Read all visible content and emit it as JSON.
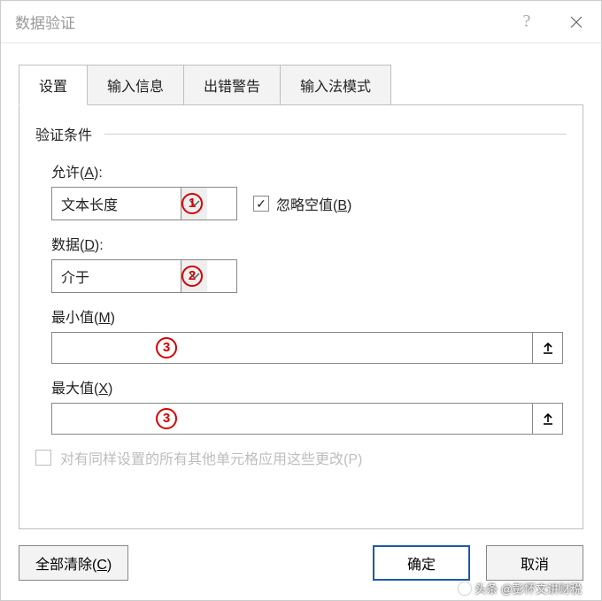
{
  "title": "数据验证",
  "tabs": {
    "settings": "设置",
    "input_msg": "输入信息",
    "error_alert": "出错警告",
    "ime_mode": "输入法模式"
  },
  "section_label": "验证条件",
  "allow": {
    "label_pre": "允许(",
    "label_u": "A",
    "label_post": "):",
    "value": "文本长度"
  },
  "ignore_blank": {
    "label_pre": "忽略空值(",
    "label_u": "B",
    "label_post": ")",
    "checked": "✓"
  },
  "data": {
    "label_pre": "数据(",
    "label_u": "D",
    "label_post": "):",
    "value": "介于"
  },
  "min": {
    "label_pre": "最小值(",
    "label_u": "M",
    "label_post": ")",
    "value": ""
  },
  "max": {
    "label_pre": "最大值(",
    "label_u": "X",
    "label_post": ")",
    "value": ""
  },
  "apply_all": {
    "text": "对有同样设置的所有其他单元格应用这些更改(P)"
  },
  "buttons": {
    "clear_pre": "全部清除(",
    "clear_u": "C",
    "clear_post": ")",
    "ok": "确定",
    "cancel": "取消"
  },
  "badges": {
    "b1": "1",
    "b2": "2",
    "b3": "3"
  },
  "watermark": "头条 @彭怀文讲财税"
}
